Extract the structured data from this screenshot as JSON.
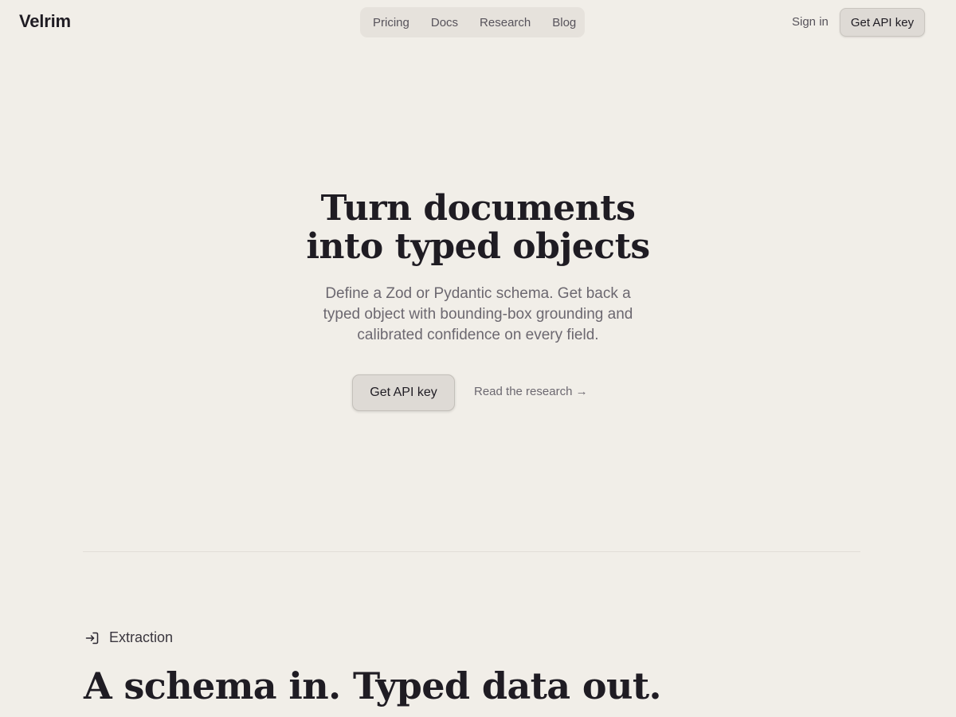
{
  "header": {
    "logo": "Velrim",
    "nav": [
      "Pricing",
      "Docs",
      "Research",
      "Blog"
    ],
    "sign_in": "Sign in",
    "cta": "Get API key"
  },
  "hero": {
    "title_line1": "Turn documents",
    "title_line2": "into typed objects",
    "subtitle": "Define a Zod or Pydantic schema. Get back a typed object with bounding-box grounding and calibrated confidence on every field.",
    "primary_cta": "Get API key",
    "secondary_link": "Read the research →"
  },
  "section": {
    "tag_icon": "sign-in-arrow-icon",
    "tag": "Extraction",
    "title": "A schema in. Typed data out."
  },
  "colors": {
    "background": "#f1eee8",
    "text": "#1f1c23",
    "muted": "#6c6870",
    "button": "#dedad5"
  }
}
